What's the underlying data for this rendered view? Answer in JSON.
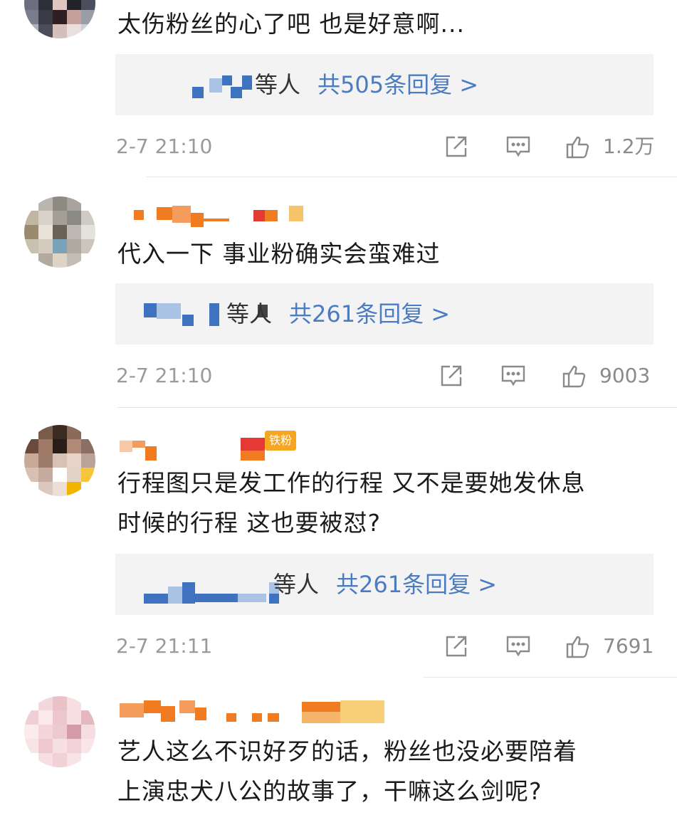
{
  "comments": [
    {
      "text_lines": [
        "太伤粉丝的心了吧 也是好意啊..."
      ],
      "reply_who": "等人",
      "reply_count": "共505条回复 >",
      "time": "2-7 21:10",
      "likes": "1.2万"
    },
    {
      "text_lines": [
        "代入一下 事业粉确实会蛮难过"
      ],
      "reply_who": "等人",
      "reply_count": "共261条回复 >",
      "time": "2-7 21:10",
      "likes": "9003"
    },
    {
      "badge": "铁粉",
      "text_lines": [
        "行程图只是发工作的行程 又不是要她发休息",
        "时候的行程 这也要被怼?"
      ],
      "reply_who": "等人",
      "reply_count": "共261条回复 >",
      "time": "2-7 21:11",
      "likes": "7691"
    },
    {
      "text_lines": [
        "艺人这么不识好歹的话，粉丝也没必要陪着",
        "上演忠犬八公的故事了，干嘛这么剑呢?"
      ]
    }
  ],
  "icons": {
    "share": "share-icon",
    "comment": "comment-icon",
    "like": "like-icon"
  },
  "colors": {
    "link_blue": "#4b7cc2",
    "meta_gray": "#9a9a9a",
    "reply_bg": "#f3f3f3",
    "username_orange": "#f07b21"
  }
}
